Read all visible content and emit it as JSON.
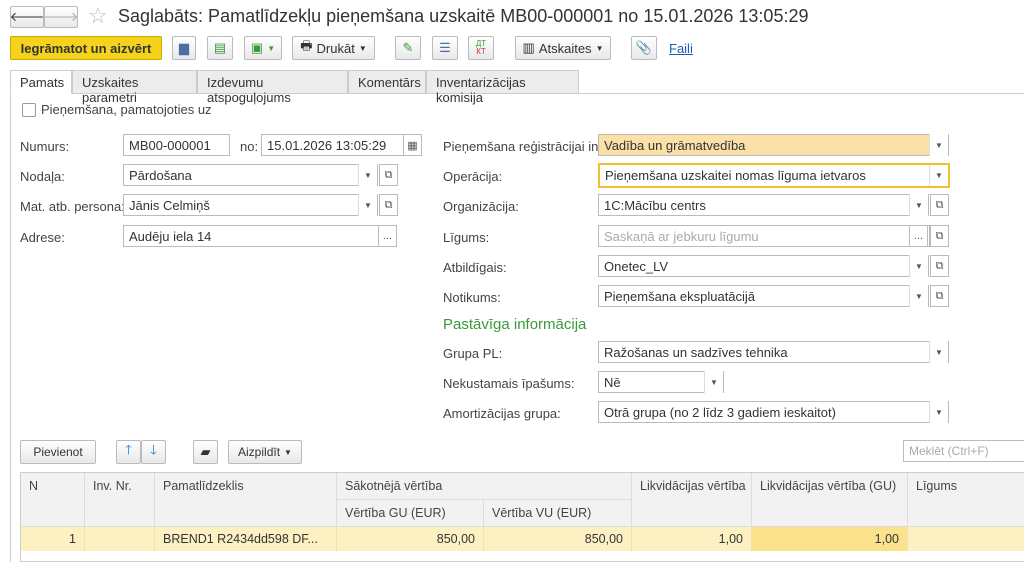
{
  "title": "Saglabāts: Pamatlīdzekļu pieņemšana uzskaitē MB00-000001 no 15.01.2026 13:05:29",
  "toolbar": {
    "post_close": "Iegrāmatot un aizvērt",
    "print": "Drukāt",
    "reports": "Atskaites",
    "files": "Faili"
  },
  "tabs": [
    "Pamats",
    "Uzskaites parametri",
    "Izdevumu atspoguļojums",
    "Komentārs",
    "Inventarizācijas komisija"
  ],
  "based_on": "Pieņemšana, pamatojoties uz",
  "left": {
    "number_label": "Numurs:",
    "number": "MB00-000001",
    "date_label": "no:",
    "date": "15.01.2026 13:05:29",
    "division_label": "Nodaļa:",
    "division": "Pārdošana",
    "person_label": "Mat. atb. persona:",
    "person": "Jānis Celmiņš",
    "address_label": "Adrese:",
    "address": "Audēju iela 14"
  },
  "right": {
    "reg_label": "Pieņemšana reģistrācijai in:",
    "reg": "Vadība un grāmatvedība",
    "op_label": "Operācija:",
    "op": "Pieņemšana uzskaitei nomas līguma ietvaros",
    "org_label": "Organizācija:",
    "org": "1C:Mācību centrs",
    "contract_label": "Līgums:",
    "contract_placeholder": "Saskaņā ar jebkuru līgumu",
    "resp_label": "Atbildīgais:",
    "resp": "Onetec_LV",
    "event_label": "Notikums:",
    "event": "Pieņemšana ekspluatācijā",
    "section": "Pastāvīga informācija",
    "group_label": "Grupa PL:",
    "group": "Ražošanas un sadzīves tehnika",
    "realestate_label": "Nekustamais īpašums:",
    "realestate": "Nē",
    "amort_label": "Amortizācijas grupa:",
    "amort": "Otrā grupa (no 2 līdz 3 gadiem ieskaitot)"
  },
  "table_toolbar": {
    "add": "Pievienot",
    "fill": "Aizpildīt",
    "search_placeholder": "Meklēt (Ctrl+F)"
  },
  "table": {
    "headers": {
      "n": "N",
      "inv": "Inv. Nr.",
      "asset": "Pamatlīdzeklis",
      "initial": "Sākotnējā vērtība",
      "gu": "Vērtība GU (EUR)",
      "vu": "Vērtība VU (EUR)",
      "liq": "Likvidācijas vērtība",
      "liq_gu": "Likvidācijas vērtība (GU)",
      "contract": "Līgums"
    },
    "rows": [
      {
        "n": "1",
        "inv": "",
        "asset": "BREND1  R2434dd598 DF...",
        "gu": "850,00",
        "vu": "850,00",
        "liq": "1,00",
        "liq_gu": "1,00",
        "contract": ""
      }
    ]
  },
  "colors": {
    "accent_button": "#f5d31c",
    "section": "#3a9a3a",
    "selected_row": "#fdf1c4",
    "highlight_cell": "#fbe38e",
    "reg_field": "#fbe0a8"
  }
}
